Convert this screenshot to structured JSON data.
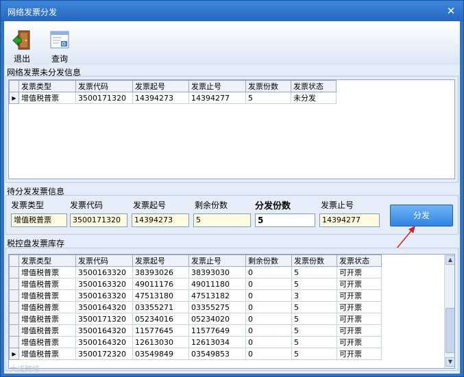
{
  "window": {
    "title": "网络发票分发",
    "close_glyph": "✕"
  },
  "toolbar": {
    "exit_label": "退出",
    "query_label": "查询"
  },
  "undistributed": {
    "label": "网络发票未分发信息",
    "columns": [
      "发票类型",
      "发票代码",
      "发票起号",
      "发票止号",
      "发票份数",
      "发票状态"
    ],
    "rows": [
      [
        "增值税普票",
        "3500171320",
        "14394273",
        "14394277",
        "5",
        "未分发"
      ]
    ]
  },
  "pending": {
    "label": "待分发发票信息",
    "type_label": "发票类型",
    "type_value": "增值税普票",
    "code_label": "发票代码",
    "code_value": "3500171320",
    "start_label": "发票起号",
    "start_value": "14394273",
    "remain_label": "剩余份数",
    "remain_value": "5",
    "count_label": "分发份数",
    "count_value": "5",
    "end_label": "发票止号",
    "end_value": "14394277",
    "distribute_button": "分发"
  },
  "inventory": {
    "label": "税控盘发票库存",
    "columns": [
      "发票类型",
      "发票代码",
      "发票起号",
      "发票止号",
      "剩余份数",
      "发票份数",
      "发票状态"
    ],
    "rows": [
      [
        "增值税普票",
        "3500163320",
        "38393026",
        "38393030",
        "0",
        "5",
        "可开票"
      ],
      [
        "增值税普票",
        "3500163320",
        "49011176",
        "49011180",
        "0",
        "5",
        "可开票"
      ],
      [
        "增值税普票",
        "3500163320",
        "47513180",
        "47513182",
        "0",
        "3",
        "可开票"
      ],
      [
        "增值税普票",
        "3500164320",
        "03355271",
        "03355275",
        "0",
        "5",
        "可开票"
      ],
      [
        "增值税普票",
        "3500171320",
        "05234016",
        "05234020",
        "0",
        "5",
        "可开票"
      ],
      [
        "增值税普票",
        "3500164320",
        "11577645",
        "11577649",
        "0",
        "5",
        "可开票"
      ],
      [
        "增值税普票",
        "3500164320",
        "12613030",
        "12613034",
        "0",
        "5",
        "可开票"
      ],
      [
        "增值税普票",
        "3500172320",
        "03549849",
        "03549853",
        "0",
        "5",
        "可开票"
      ]
    ],
    "current_row": 7
  },
  "watermark": "大成跨境",
  "icons": {
    "exit": "door-exit-icon",
    "query": "query-window-icon",
    "current_row": "row-pointer-icon"
  }
}
